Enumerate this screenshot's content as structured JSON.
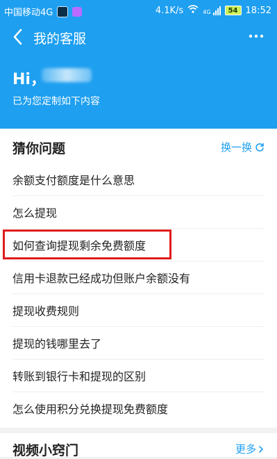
{
  "status_bar": {
    "carrier": "中国移动4G",
    "network_speed": "4.1K/s",
    "signal_label": "4G",
    "battery": "54",
    "time": "18:52"
  },
  "header": {
    "title": "我的客服",
    "greeting": "Hi，",
    "subtitle": "已为您定制如下内容"
  },
  "guess_section": {
    "title": "猜你问题",
    "refresh_label": "换一换",
    "items": [
      "余额支付额度是什么意思",
      "怎么提现",
      "如何查询提现剩余免费额度",
      "信用卡退款已经成功但账户余额没有",
      "提现收费规则",
      "提现的钱哪里去了",
      "转账到银行卡和提现的区别",
      "怎么使用积分兑换提现免费额度"
    ]
  },
  "video_section": {
    "title": "视频小窍门",
    "more_label": "更多"
  },
  "colors": {
    "accent": "#1e9ff0",
    "highlight_box": "#e01b1b"
  }
}
